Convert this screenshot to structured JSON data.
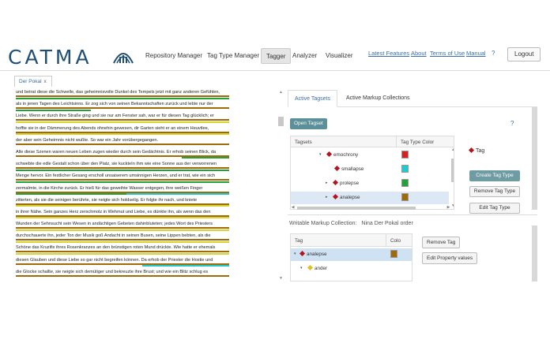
{
  "header": {
    "logo": "CATMA",
    "logo_icon": "catma-logo-icon",
    "nav_tabs": [
      "Repository Manager",
      "Tag Type Manager",
      "Tagger",
      "Analyzer",
      "Visualizer"
    ],
    "active_tab": "Tagger",
    "links": [
      "Latest Features",
      "About",
      "Terms of Use",
      "Manual"
    ],
    "help": "?",
    "logout": "Logout"
  },
  "document": {
    "tab_label": "Der Pokal",
    "close": "x",
    "lines": [
      "und betrat diese die Schwelle, das geheimnisvolle Dunkel des Tempels jetzt mit ganz anderen Gefühlen,",
      "als in jenen Tagen des Leichtsinns. Er zog sich von seinen Bekanntschaften zurück und lebte nur der",
      "Liebe. Wenn er durch ihre Straße ging und sie nur am Fenster sah, war er für diesen Tag glücklich; er",
      "hoffte sie in der Dämmerung des Abends ohnehin gewesen, dir Garten sieht er an einem Heuvtlee,",
      "der aber sein Geheimnis nicht wußte. So war ein Jahr vorübergegangen.",
      "Alle diese Szenen waren neuen Leben zugen wieder durch sein Gedächtnis. Er erhob seinen Blick, da",
      "schwebte die edle Gestalt schon über den Platz, sie kuckteIn ihm wie eine Sonne aus der verworrenen",
      "Menge hervor. Ein festlicher Gesang erscholl unsaiserem umsinnigen Herzen, und er trat, wie ein sich",
      "zermalmte, in die Kirche zurück. Er hieß für das geweihte Wasser entgegen, ihre weißen Finger",
      "zitterten, als sie die seinigen berührte, sie neigte sich holdselig. Er folgte ihr nach, und kniete",
      "in ihrer Nähe. Sein ganzes Herz zerschmolz in Wehmut und Liebe, es dünkte ihn, als wenn das den",
      "Wunden der Sehnsucht sein Wesen in andächtigen Gebeten dahinbluteten; jedes Wort des Priesters",
      "durchschauerte ihn, jeder Ton der Musik goß Andacht in seinen Busen, seine Lippen bebten, als die",
      "Schöne das Kruzifix ihres Rosenkranzes an den brünstigen roten Mund drückte. Wie hatte er ehemals",
      "diesen Glauben und diese Liebe so gar nicht begreifen können. Da erhob der Priester die Hostie und",
      "die Glocke schallte, sie neigte sich demütiger und bekreuzte ihre Brust; und wie ein Blitz schlug es"
    ]
  },
  "tagger": {
    "tabs": [
      "Active Tagsets",
      "Active Markup Collections"
    ],
    "open_tagset": "Open Tagset",
    "help": "?",
    "columns": [
      "Tagsets",
      "Tag Type Color"
    ],
    "rows": [
      {
        "label": "emochrony",
        "color": "#d42222",
        "arrow": "▾"
      },
      {
        "label": "smallapse",
        "color": "#1ec9cf",
        "arrow": ""
      },
      {
        "label": "prolepse",
        "color": "#23a23a",
        "arrow": "▸"
      },
      {
        "label": "analepse",
        "color": "#a06a0a",
        "arrow": "▸"
      }
    ],
    "preview_tag": "Tag",
    "buttons": [
      "Create Tag Type",
      "Remove Tag Type",
      "Edit Tag Type"
    ],
    "writable_label": "Writable Markup Collection:",
    "writable_value": "Nina Der Pokal order",
    "wmc_columns": [
      "Tag",
      "Colo"
    ],
    "wmc_rows": [
      {
        "label": "analepse",
        "color": "#a06a0a",
        "arrow": "▾"
      },
      {
        "label": "ander",
        "color": "",
        "arrow": "▾"
      }
    ],
    "wmc_buttons": [
      "Remove Tag",
      "Edit Property values"
    ]
  }
}
